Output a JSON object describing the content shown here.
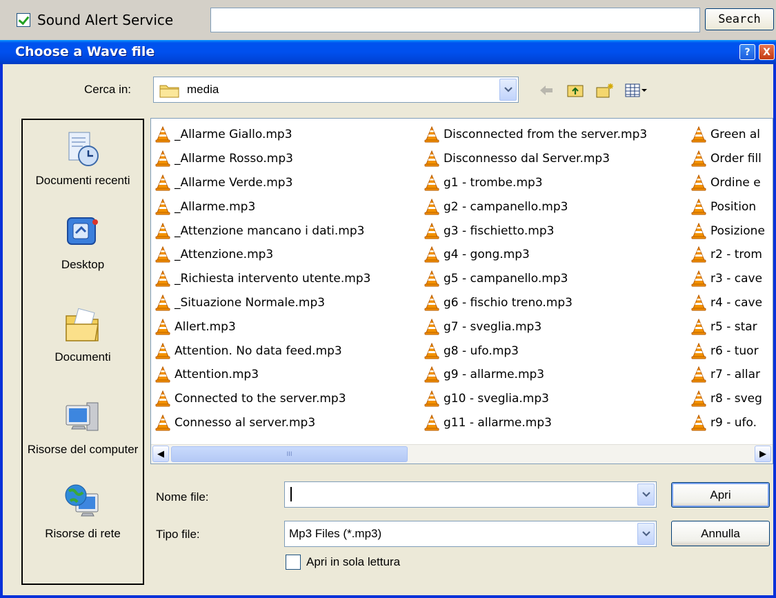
{
  "topbar": {
    "checkbox_label": "Sound Alert Service",
    "checked": true,
    "search_value": "",
    "search_button": "Search"
  },
  "dialog": {
    "title": "Choose a Wave file",
    "help_glyph": "?",
    "close_glyph": "X",
    "look_in_label": "Cerca in:",
    "look_in_value": "media",
    "places": [
      {
        "label": "Documenti recenti",
        "icon": "recent-documents-icon"
      },
      {
        "label": "Desktop",
        "icon": "desktop-icon"
      },
      {
        "label": "Documenti",
        "icon": "documents-folder-icon"
      },
      {
        "label": "Risorse del computer",
        "icon": "my-computer-icon"
      },
      {
        "label": "Risorse di rete",
        "icon": "network-icon"
      }
    ],
    "files": {
      "col1": [
        "_Allarme Giallo.mp3",
        "_Allarme Rosso.mp3",
        "_Allarme Verde.mp3",
        "_Allarme.mp3",
        "_Attenzione mancano i dati.mp3",
        "_Attenzione.mp3",
        "_Richiesta intervento utente.mp3",
        "_Situazione Normale.mp3",
        "Allert.mp3",
        "Attention. No data feed.mp3",
        "Attention.mp3",
        "Connected to the server.mp3",
        "Connesso al server.mp3"
      ],
      "col2": [
        "Disconnected from the server.mp3",
        "Disconnesso dal Server.mp3",
        "g1 - trombe.mp3",
        "g2 - campanello.mp3",
        "g3 - fischietto.mp3",
        "g4 - gong.mp3",
        "g5 - campanello.mp3",
        "g6 - fischio treno.mp3",
        "g7 - sveglia.mp3",
        "g8 - ufo.mp3",
        "g9 - allarme.mp3",
        "g10 - sveglia.mp3",
        "g11 - allarme.mp3"
      ],
      "col3": [
        "Green al",
        "Order fill",
        "Ordine e",
        "Position",
        "Posizione",
        "r2 - trom",
        "r3 - cave",
        "r4 - cave",
        "r5 - star",
        "r6 - tuor",
        "r7 - allar",
        "r8 - sveg",
        "r9 - ufo."
      ]
    },
    "scroll_thumb_grip": "III",
    "file_name_label": "Nome file:",
    "file_name_value": "",
    "file_type_label": "Tipo file:",
    "file_type_value": "Mp3 Files (*.mp3)",
    "open_button": "Apri",
    "cancel_button": "Annulla",
    "readonly_label": "Apri in sola lettura",
    "readonly_checked": false
  },
  "colors": {
    "titlebar": "#0053ee",
    "dialog_bg": "#ece9d8",
    "file_icon": "#f08a00"
  }
}
